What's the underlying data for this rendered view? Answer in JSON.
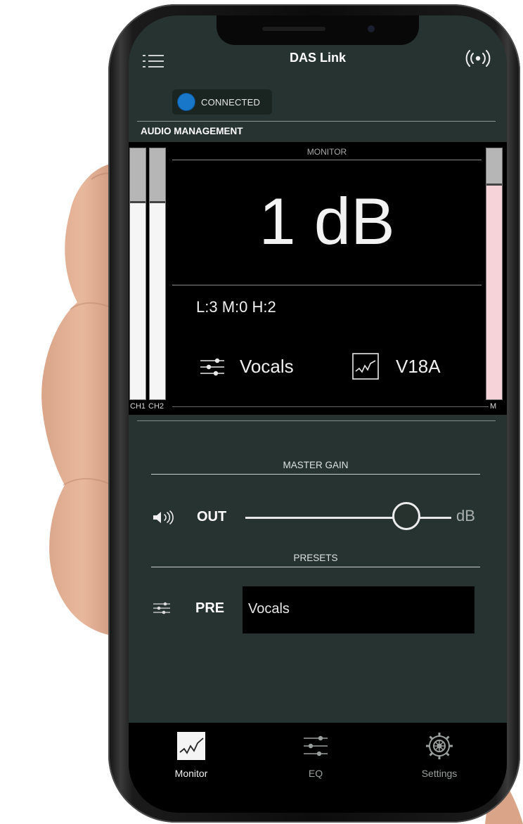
{
  "app": {
    "title": "DAS Link",
    "menu_icon": "hamburger-menu-icon",
    "broadcast_icon": "broadcast-icon"
  },
  "status": {
    "label": "CONNECTED",
    "color": "#1877c9"
  },
  "section_title": "AUDIO MANAGEMENT",
  "monitor": {
    "label": "MONITOR",
    "value": "1 dB",
    "band_levels": "L:3 M:0 H:2",
    "preset": "Vocals",
    "speaker_model": "V18A",
    "meters": [
      {
        "label": "CH1",
        "level": 0.78
      },
      {
        "label": "CH2",
        "level": 0.78
      },
      {
        "label": "M",
        "level": 0.86
      }
    ]
  },
  "master_gain": {
    "label": "MASTER GAIN",
    "out_label": "OUT",
    "unit": "dB",
    "slider_position": 0.78
  },
  "presets": {
    "label": "PRESETS",
    "pre_label": "PRE",
    "selected": "Vocals"
  },
  "tabs": [
    {
      "label": "Monitor",
      "icon": "monitor-graph-icon",
      "active": true
    },
    {
      "label": "EQ",
      "icon": "eq-sliders-icon",
      "active": false
    },
    {
      "label": "Settings",
      "icon": "gear-icon",
      "active": false
    }
  ],
  "colors": {
    "screen_bg": "#273330",
    "panel_bg": "#000000",
    "accent_blue": "#1877c9",
    "master_meter": "#f5d3d8"
  }
}
